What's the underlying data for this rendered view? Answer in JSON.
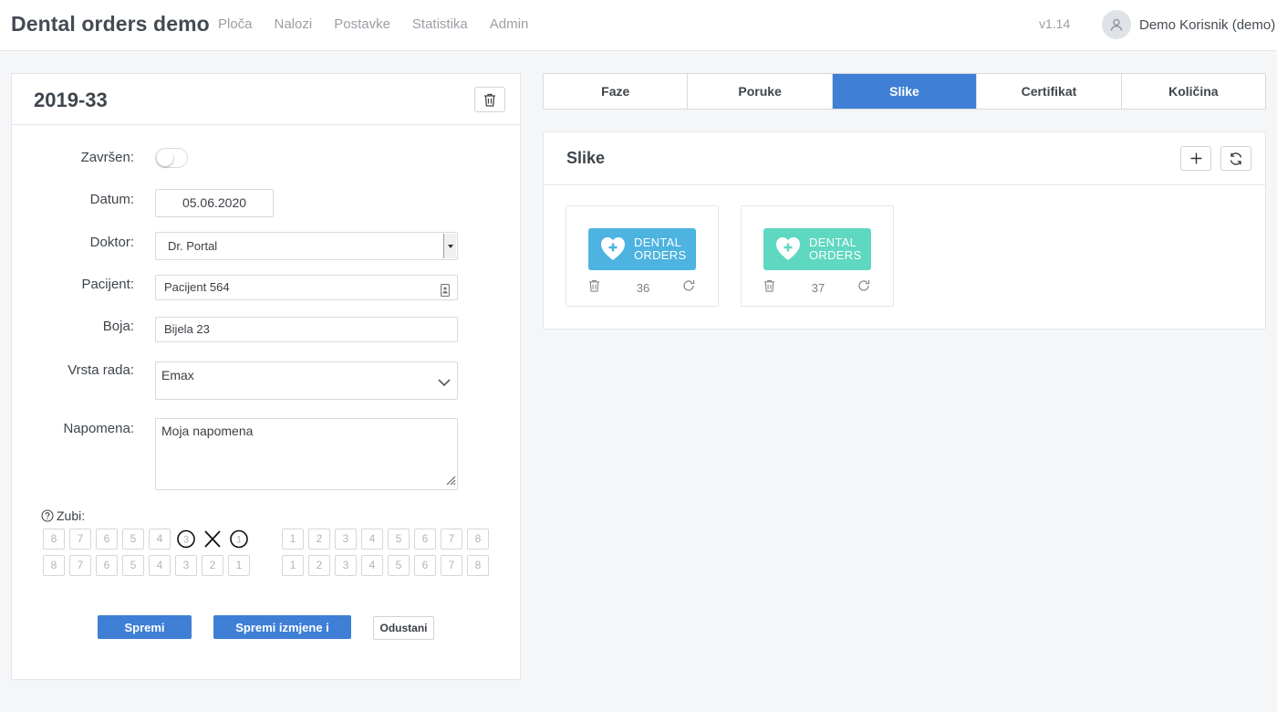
{
  "app": {
    "title": "Dental orders demo",
    "nav": [
      "Ploča",
      "Nalozi",
      "Postavke",
      "Statistika",
      "Admin"
    ],
    "version": "v1.14",
    "user_name": "Demo Korisnik (demo)"
  },
  "order": {
    "title": "2019-33",
    "labels": {
      "completed": "Završen:",
      "date": "Datum:",
      "doctor": "Doktor:",
      "patient": "Pacijent:",
      "color": "Boja:",
      "work_type": "Vrsta rada:",
      "note": "Napomena:",
      "teeth": "Zubi:"
    },
    "completed": false,
    "date": "05.06.2020",
    "doctor": "Dr. Portal",
    "patient": "Pacijent 564",
    "color": "Bijela 23",
    "work_type": "Emax",
    "note": "Moja napomena",
    "teeth": {
      "upper_left": [
        "8",
        "7",
        "6",
        "5",
        "4",
        "3",
        "2",
        "1"
      ],
      "upper_right": [
        "1",
        "2",
        "3",
        "4",
        "5",
        "6",
        "7",
        "8"
      ],
      "lower_left": [
        "8",
        "7",
        "6",
        "5",
        "4",
        "3",
        "2",
        "1"
      ],
      "lower_right": [
        "1",
        "2",
        "3",
        "4",
        "5",
        "6",
        "7",
        "8"
      ],
      "upper_left_marks": {
        "3": "circle",
        "2": "cross",
        "1": "circle"
      }
    },
    "buttons": {
      "save": "Spremi izmjene",
      "save_close": "Spremi izmjene i zatvori",
      "cancel": "Odustani"
    }
  },
  "tabs": [
    {
      "label": "Faze",
      "active": false
    },
    {
      "label": "Poruke",
      "active": false
    },
    {
      "label": "Slike",
      "active": true
    },
    {
      "label": "Certifikat",
      "active": false
    },
    {
      "label": "Količina",
      "active": false
    }
  ],
  "images_panel": {
    "title": "Slike",
    "images": [
      {
        "id": "36",
        "logo_line1": "DENTAL",
        "logo_line2": "ORDERS",
        "color": "#4db3e0"
      },
      {
        "id": "37",
        "logo_line1": "DENTAL",
        "logo_line2": "ORDERS",
        "color": "#5ed8c0"
      }
    ]
  },
  "colors": {
    "accent": "#3f7fd6"
  }
}
